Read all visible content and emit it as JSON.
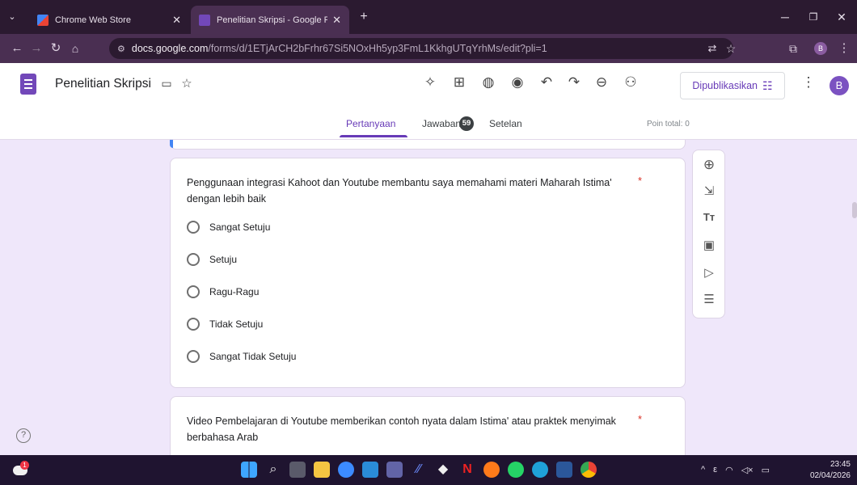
{
  "browser": {
    "tabs": [
      {
        "title": "Chrome Web Store",
        "active": false
      },
      {
        "title": "Penelitian Skripsi - Google Form",
        "active": true
      }
    ],
    "new_tab_icon": "plus-icon",
    "url_host": "docs.google.com",
    "url_path": "/forms/d/1ETjArCH2bFrhr67Si5NOxHh5yp3FmL1KkhgUTqYrhMs/edit?pli=1",
    "profile_initial": "B"
  },
  "header": {
    "form_title": "Penelitian Skripsi",
    "publish_label": "Dipublikasikan",
    "avatar_initial": "B",
    "tabs": {
      "questions": "Pertanyaan",
      "responses": "Jawaban",
      "responses_count": "59",
      "settings": "Setelan"
    },
    "points_total": "Poin total: 0"
  },
  "questions": [
    {
      "text": "Penggunaan integrasi Kahoot dan Youtube membantu saya memahami materi Maharah Istima' dengan lebih baik",
      "required_mark": "*",
      "options": [
        "Sangat Setuju",
        "Setuju",
        "Ragu-Ragu",
        "Tidak Setuju",
        "Sangat Tidak Setuju"
      ]
    },
    {
      "text": "Video Pembelajaran di Youtube memberikan contoh nyata dalam Istima' atau praktek menyimak berbahasa Arab",
      "required_mark": "*"
    }
  ],
  "side_toolbar": [
    "add-question-icon",
    "import-questions-icon",
    "add-title-icon",
    "add-image-icon",
    "add-video-icon",
    "add-section-icon"
  ],
  "taskbar": {
    "weather_badge": "1",
    "time": "23:45",
    "date": "02/04/2026",
    "tray_lang": "ε"
  },
  "colors": {
    "accent": "#673ab7",
    "background": "#efe7fa",
    "required": "#d93025",
    "chrome_dark": "#2b1a30"
  }
}
